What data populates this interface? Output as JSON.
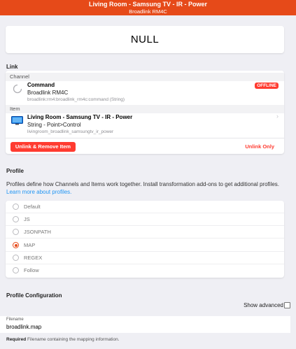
{
  "navbar": {
    "title": "Living Room - Samsung TV - IR - Power",
    "subtitle": "Broadlink RM4C"
  },
  "state": {
    "value": "NULL"
  },
  "link": {
    "section_title": "Link",
    "channel_header": "Channel",
    "channel": {
      "title": "Command",
      "subtitle": "Broadlink RM4C",
      "footer": "broadlink:rm4:broadlink_rm4c:command (String)",
      "status_badge": "OFFLINE",
      "icon": "spinner-icon"
    },
    "item_header": "Item",
    "item": {
      "title": "Living Room - Samsung TV - IR - Power",
      "subtitle": "String - Point>Control",
      "footer": "livingroom_broadlink_samsungtv_ir_power",
      "icon": "tv-icon",
      "chevron": "›"
    },
    "unlink_remove_label": "Unlink & Remove Item",
    "unlink_only_label": "Unlink Only"
  },
  "profile": {
    "section_title": "Profile",
    "description": "Profiles define how Channels and Items work together. Install transformation add-ons to get additional profiles.",
    "learn_more": "Learn more about profiles.",
    "options": [
      {
        "label": "Default",
        "selected": false
      },
      {
        "label": "JS",
        "selected": false
      },
      {
        "label": "JSONPATH",
        "selected": false
      },
      {
        "label": "MAP",
        "selected": true
      },
      {
        "label": "REGEX",
        "selected": false
      },
      {
        "label": "Follow",
        "selected": false
      }
    ]
  },
  "profile_config": {
    "section_title": "Profile Configuration",
    "show_advanced_label": "Show advanced",
    "show_advanced_checked": false,
    "filename_label": "Filename",
    "filename_value": "broadlink.map",
    "required_label": "Required",
    "help_text": "Filename containing the mapping information."
  },
  "colors": {
    "accent": "#e64a19",
    "danger": "#ff3b30",
    "link": "#2196f3"
  }
}
